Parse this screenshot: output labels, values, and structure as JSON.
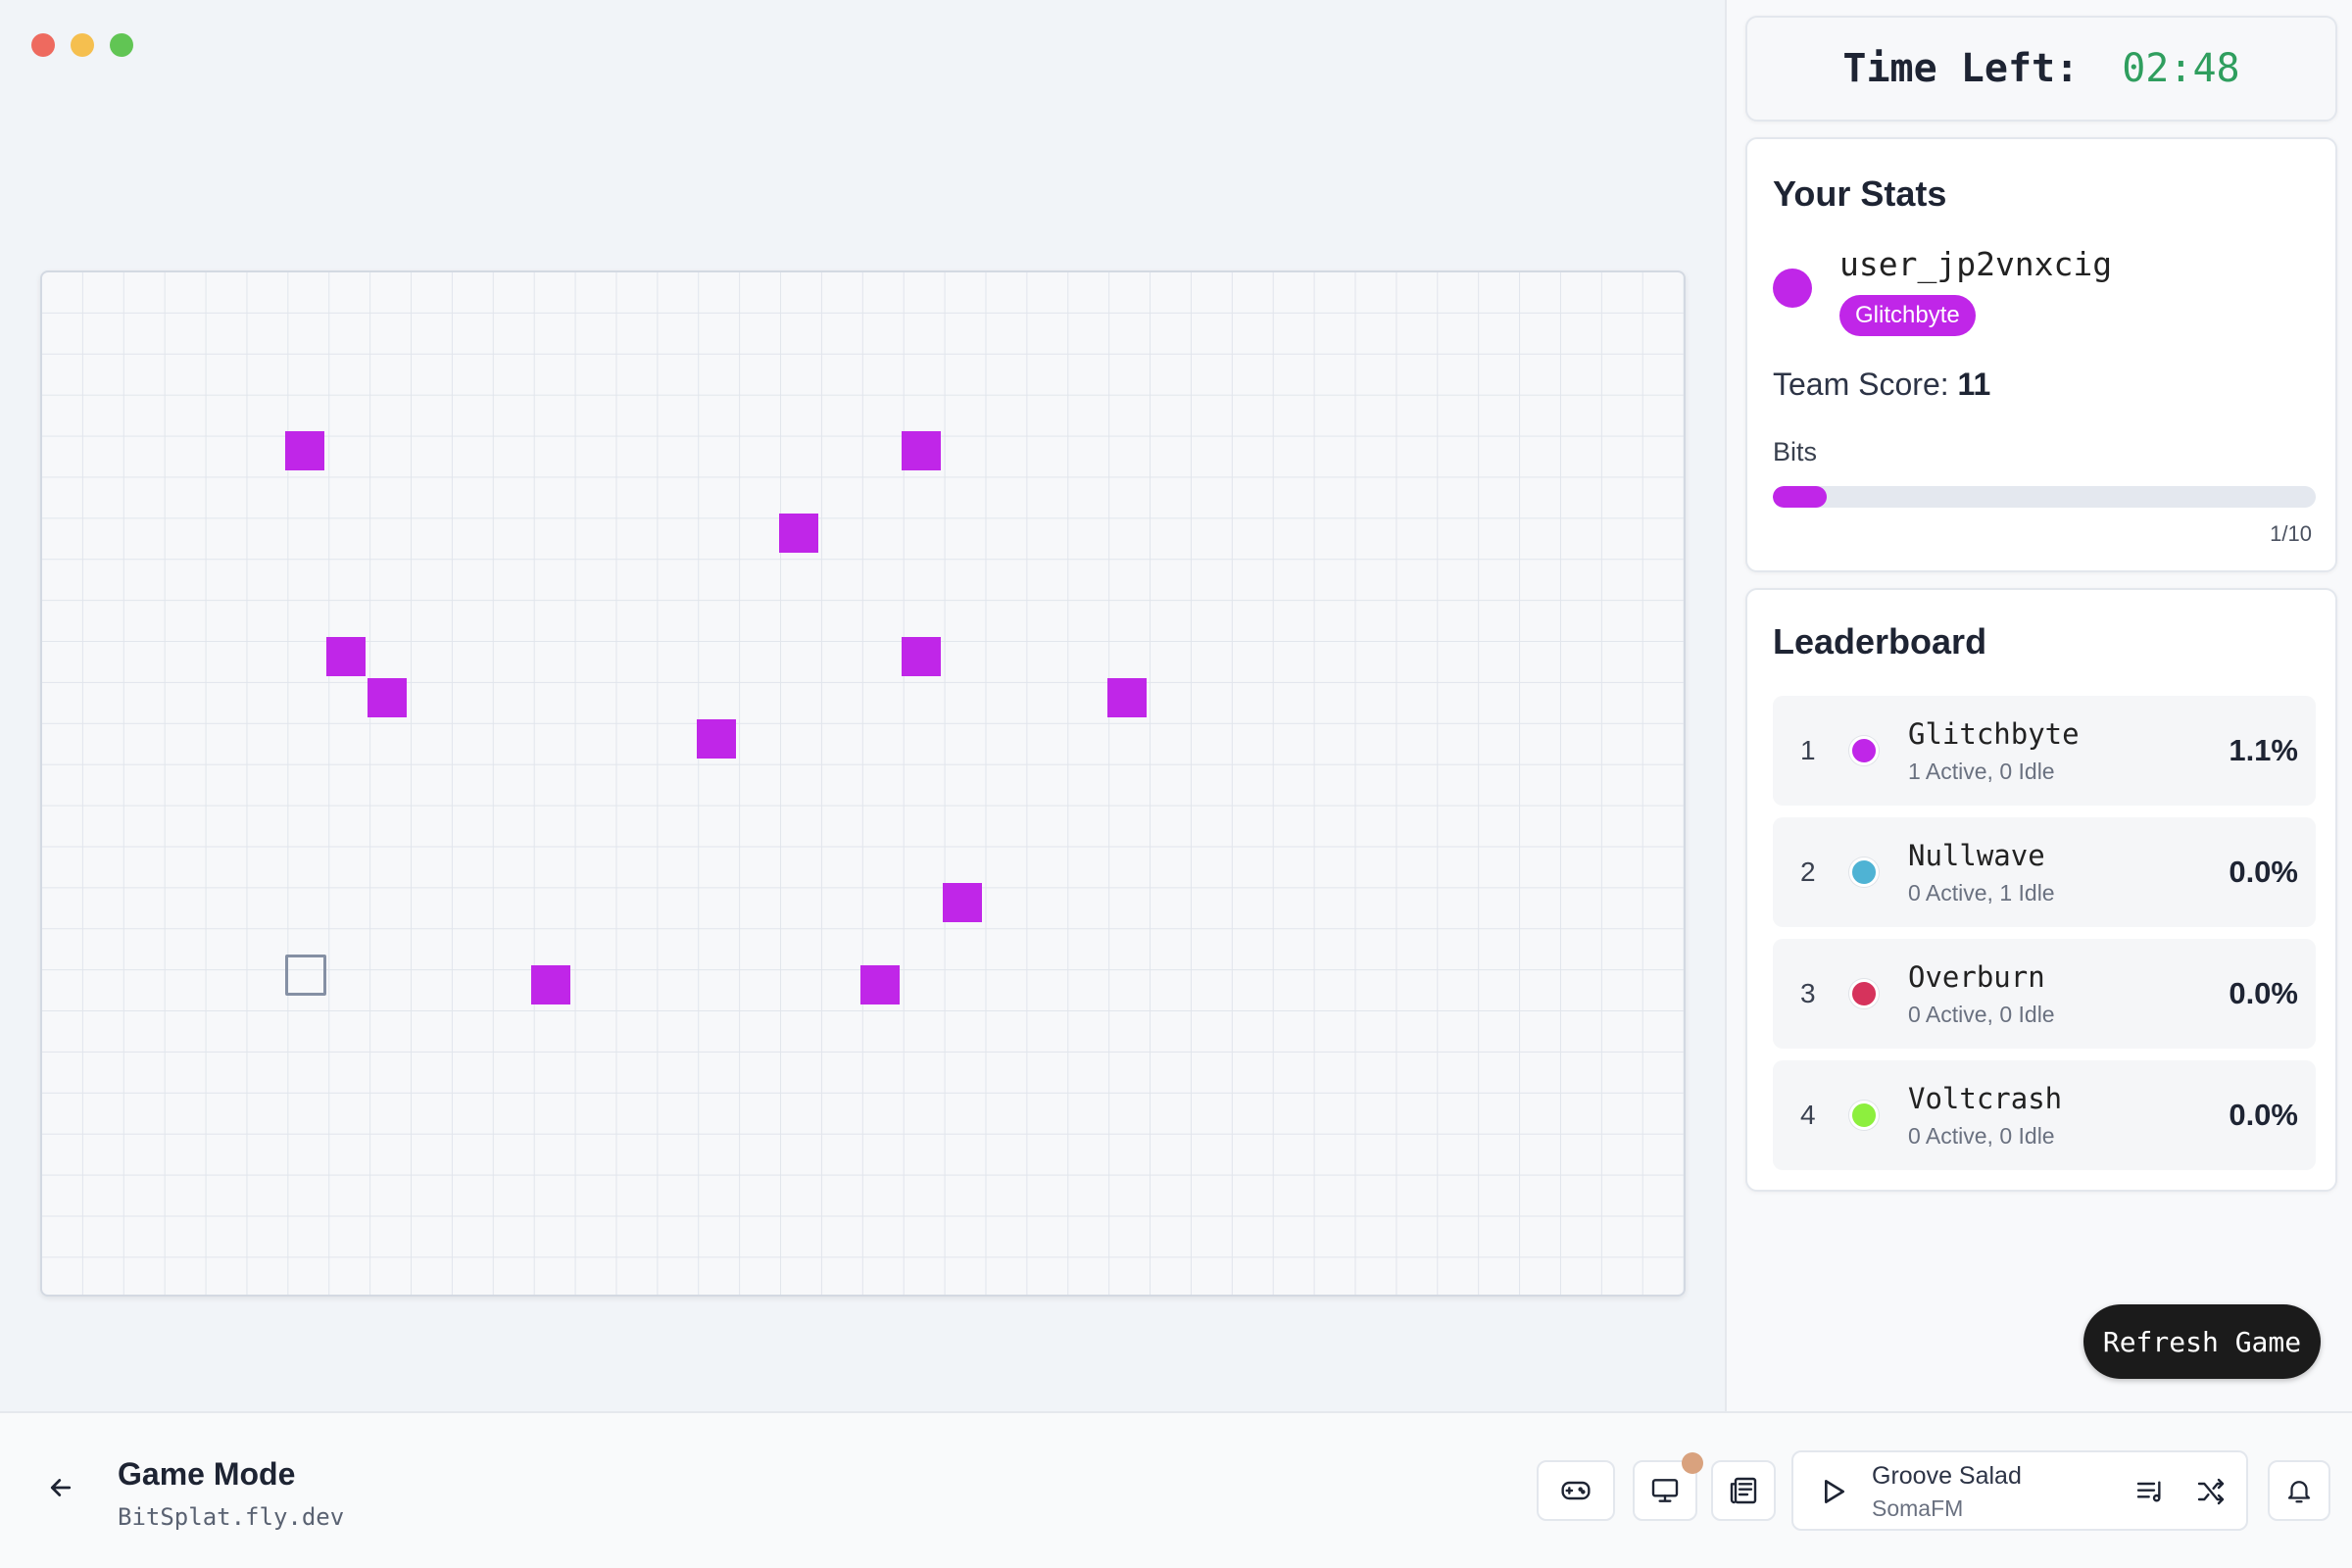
{
  "window_controls": {
    "close_color": "#ee6a5f",
    "minimize_color": "#f5bf4f",
    "maximize_color": "#61c554"
  },
  "board": {
    "cols": 40,
    "rows": 25,
    "team_color": "#c026e8"
  },
  "timer": {
    "label": "Time Left:",
    "value": "02:48"
  },
  "stats": {
    "title": "Your Stats",
    "username": "user_jp2vnxcig",
    "team": "Glitchbyte",
    "team_color": "#c026e8",
    "team_score_label": "Team Score:",
    "team_score": "11",
    "bits_label": "Bits",
    "bits_value": 1,
    "bits_max": 10,
    "bits_text": "1/10"
  },
  "leaderboard": {
    "title": "Leaderboard",
    "teams": [
      {
        "rank": "1",
        "name": "Glitchbyte",
        "color": "#c026e8",
        "status": "1 Active, 0 Idle",
        "percent": "1.1%"
      },
      {
        "rank": "2",
        "name": "Nullwave",
        "color": "#4fb3d4",
        "status": "0 Active, 1 Idle",
        "percent": "0.0%"
      },
      {
        "rank": "3",
        "name": "Overburn",
        "color": "#d6335c",
        "status": "0 Active, 0 Idle",
        "percent": "0.0%"
      },
      {
        "rank": "4",
        "name": "Voltcrash",
        "color": "#8def3e",
        "status": "0 Active, 0 Idle",
        "percent": "0.0%"
      }
    ]
  },
  "refresh_button": "Refresh Game",
  "bottombar": {
    "title": "Game Mode",
    "subtitle": "BitSplat.fly.dev",
    "icons": [
      "gamepad-icon",
      "monitor-icon",
      "newspaper-icon"
    ],
    "player": {
      "title": "Groove Salad",
      "station": "SomaFM"
    },
    "notification_color": "#d9a27e"
  }
}
